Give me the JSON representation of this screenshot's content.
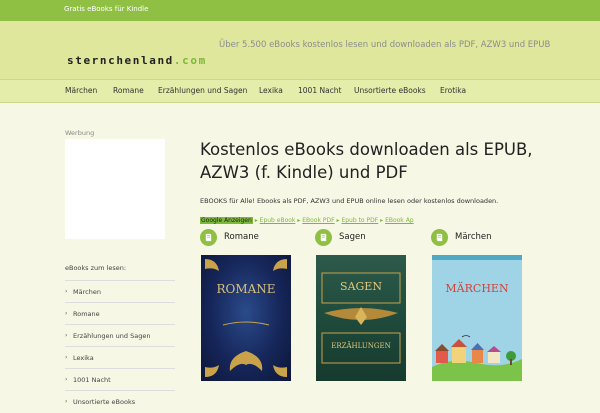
{
  "topbar": {
    "label": "Gratis eBooks für Kindle"
  },
  "header": {
    "logo_main": "sternchenland",
    "logo_tld": ".com",
    "tagline": "Über 5.500 eBooks kostenlos lesen und downloaden als PDF, AZW3 und EPUB"
  },
  "nav": [
    {
      "label": "Märchen"
    },
    {
      "label": "Romane"
    },
    {
      "label": "Erzählungen und Sagen"
    },
    {
      "label": "Lexika"
    },
    {
      "label": "1001 Nacht"
    },
    {
      "label": "Unsortierte eBooks"
    },
    {
      "label": "Erotika"
    }
  ],
  "sidebar": {
    "ad_label": "Werbung",
    "heading": "eBooks zum lesen:",
    "items": [
      {
        "label": "Märchen"
      },
      {
        "label": "Romane"
      },
      {
        "label": "Erzählungen und Sagen"
      },
      {
        "label": "Lexika"
      },
      {
        "label": "1001 Nacht"
      },
      {
        "label": "Unsortierte eBooks"
      }
    ]
  },
  "main": {
    "title": "Kostenlos eBooks downloaden als EPUB, AZW3 (f. Kindle) und PDF",
    "intro": "EBOOKS für Alle! Ebooks als PDF, AZW3 und EPUB online lesen oder kostenlos downloaden.",
    "ads": {
      "label": "Google Anzeigen",
      "links": [
        "Epub eBook",
        "EBook PDF",
        "Epub to PDF",
        "EBook Ap"
      ]
    },
    "categories": [
      {
        "label": "Romane",
        "cover_title": "ROMANE",
        "cover_subtitle": ""
      },
      {
        "label": "Sagen",
        "cover_title": "SAGEN",
        "cover_subtitle": "ERZÄHLUNGEN"
      },
      {
        "label": "Märchen",
        "cover_title": "MÄRCHEN",
        "cover_subtitle": ""
      }
    ]
  },
  "colors": {
    "accent": "#8fc043",
    "header_bg": "#dfe79c",
    "page_bg": "#f6f7e4"
  }
}
